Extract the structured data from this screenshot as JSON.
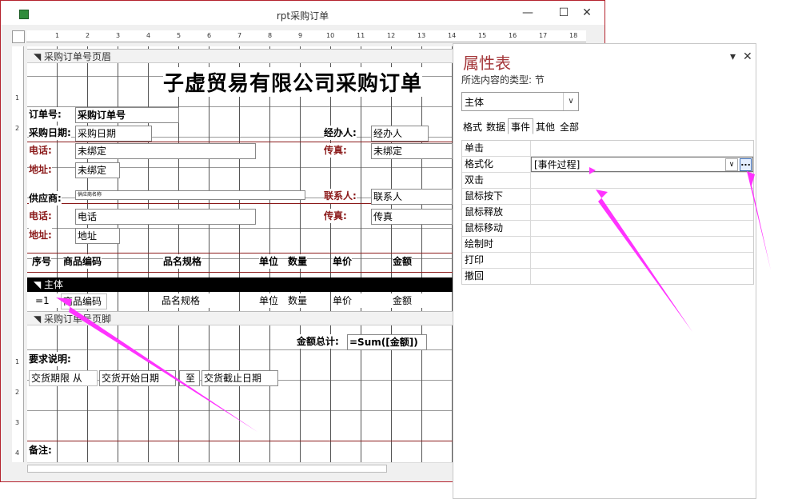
{
  "window": {
    "title": "rpt采购订单",
    "minimize": "—",
    "maximize": "☐",
    "close": "✕"
  },
  "ruler": {
    "top_numbers": [
      "1",
      "2",
      "3",
      "4",
      "5",
      "6",
      "7",
      "8",
      "9",
      "10",
      "11",
      "12",
      "13",
      "14",
      "15",
      "16",
      "17",
      "18"
    ],
    "left_numbers": [
      "1",
      "2",
      "1",
      "2",
      "3",
      "4"
    ]
  },
  "sections": {
    "page_header": "采购订单号页眉",
    "detail": "主体",
    "page_footer": "采购订单号页脚"
  },
  "report": {
    "title": "子虚贸易有限公司采购订单",
    "order_no_label": "订单号:",
    "order_no_field": "采购订单号",
    "date_label": "采购日期:",
    "date_field": "采购日期",
    "handler_label": "经办人:",
    "handler_field": "经办人",
    "phone_label_1": "电话:",
    "phone_value_1": "未绑定",
    "fax_label_1": "传真:",
    "fax_value_1": "未绑定",
    "address_label_1": "地址:",
    "address_value_1": "未绑定",
    "supplier_label": "供应商:",
    "supplier_value": "供应商名称",
    "contact_label": "联系人:",
    "contact_field": "联系人",
    "phone_label_2": "电话:",
    "phone_field_2": "电话",
    "fax_label_2": "传真:",
    "fax_field_2": "传真",
    "address_label_2": "地址:",
    "address_field_2": "地址",
    "columns": [
      "序号",
      "商品编码",
      "品名规格",
      "单位",
      "数量",
      "单价",
      "金额"
    ],
    "detail_fields": [
      "=1",
      "商品编码",
      "品名规格",
      "单位",
      "数量",
      "单价",
      "金额"
    ],
    "total_label": "金额总计:",
    "total_expr": "=Sum([金额])",
    "requirements_label": "要求说明:",
    "delivery_from": "交货期限 从",
    "delivery_start": "交货开始日期",
    "to": "至",
    "delivery_end": "交货截止日期",
    "notes_label": "备注:"
  },
  "property_sheet": {
    "title": "属性表",
    "subtitle": "所选内容的类型: 节",
    "close": "✕",
    "pin": "▾",
    "selector_value": "主体",
    "tabs": [
      "格式",
      "数据",
      "事件",
      "其他",
      "全部"
    ],
    "active_tab": "事件",
    "rows": [
      {
        "name": "单击",
        "value": ""
      },
      {
        "name": "格式化",
        "value": "[事件过程]"
      },
      {
        "name": "双击",
        "value": ""
      },
      {
        "name": "鼠标按下",
        "value": ""
      },
      {
        "name": "鼠标释放",
        "value": ""
      },
      {
        "name": "鼠标移动",
        "value": ""
      },
      {
        "name": "绘制时",
        "value": ""
      },
      {
        "name": "打印",
        "value": ""
      },
      {
        "name": "撤回",
        "value": ""
      }
    ],
    "builder_button": "...",
    "dropdown_arrow": "∨"
  },
  "colors": {
    "accent": "#a4373a",
    "annotation_arrow": "#ff33ff",
    "detail_band": "#000000"
  },
  "icons": {
    "app": "access-report-icon",
    "section": "section-arrow-icon"
  }
}
